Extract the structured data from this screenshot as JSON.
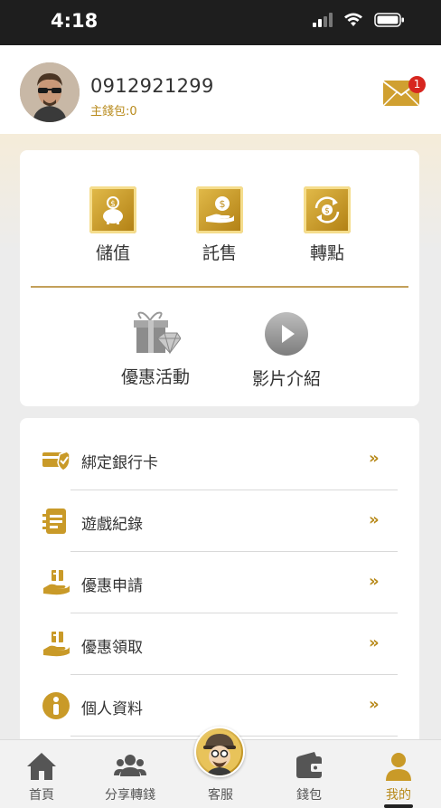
{
  "status_bar": {
    "time": "4:18"
  },
  "profile": {
    "phone": "0912921299",
    "wallet_label": "主錢包:0",
    "mail_badge": "1"
  },
  "actions": [
    {
      "label": "儲值",
      "icon": "piggy-bank-coin-icon"
    },
    {
      "label": "託售",
      "icon": "hand-coin-icon"
    },
    {
      "label": "轉點",
      "icon": "coin-exchange-icon"
    }
  ],
  "secondary_actions": [
    {
      "label": "優惠活動",
      "icon": "gift-diamond-icon"
    },
    {
      "label": "影片介紹",
      "icon": "play-icon"
    }
  ],
  "menu": [
    {
      "label": "綁定銀行卡",
      "icon": "bank-card-shield-icon",
      "arrow": "»"
    },
    {
      "label": "遊戲紀錄",
      "icon": "game-record-icon",
      "arrow": "»"
    },
    {
      "label": "優惠申請",
      "icon": "promo-apply-icon",
      "arrow": "»"
    },
    {
      "label": "優惠領取",
      "icon": "promo-claim-icon",
      "arrow": "»"
    },
    {
      "label": "個人資料",
      "icon": "info-icon",
      "arrow": "»"
    }
  ],
  "tabbar": {
    "items": [
      {
        "label": "首頁",
        "icon": "home-icon"
      },
      {
        "label": "分享轉錢",
        "icon": "users-icon"
      },
      {
        "label": "客服",
        "icon": "support-mascot-icon"
      },
      {
        "label": "錢包",
        "icon": "wallet-icon"
      },
      {
        "label": "我的",
        "icon": "user-icon"
      }
    ],
    "active_index": 4
  },
  "colors": {
    "gold": "#b88a1b",
    "badge_red": "#d7261f",
    "status_bar": "#1e1e1e"
  }
}
